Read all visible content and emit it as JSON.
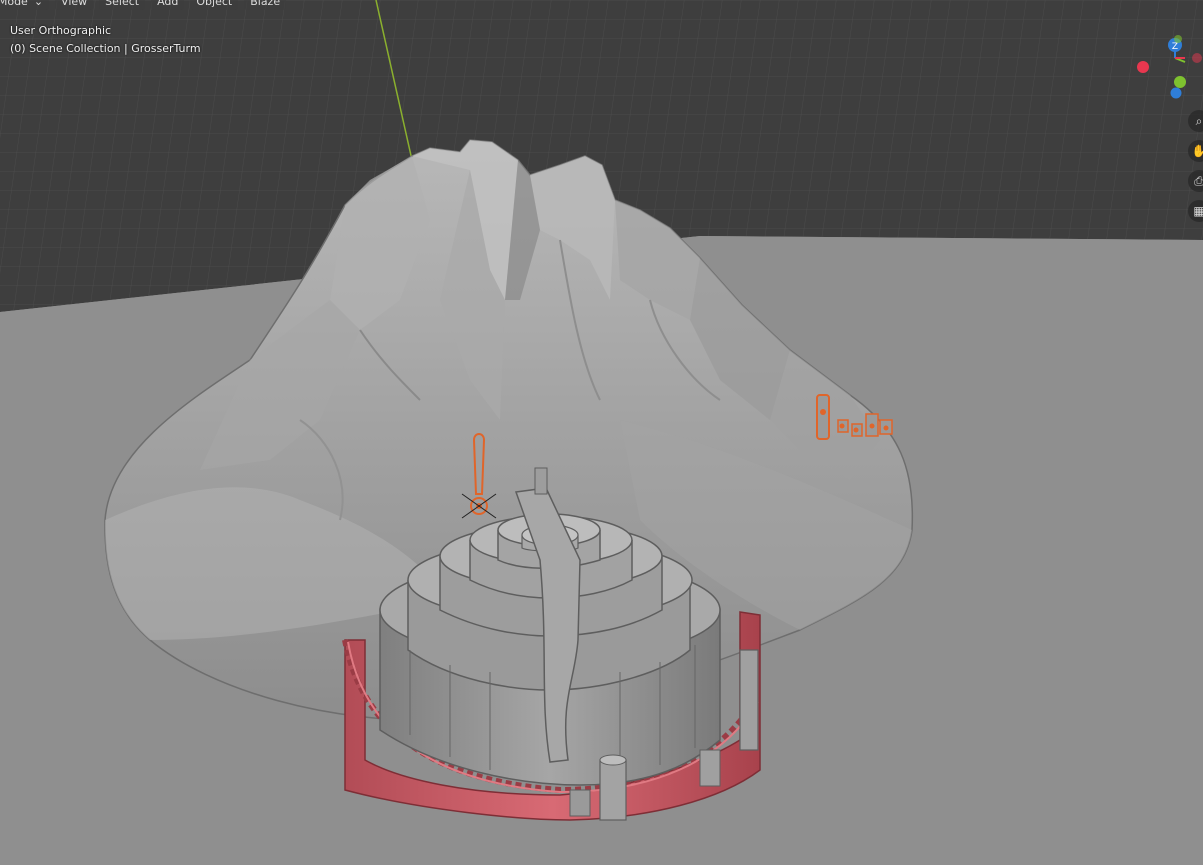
{
  "header": {
    "mode_label": "ct Mode",
    "menu": [
      "View",
      "Select",
      "Add",
      "Object",
      "Blaze"
    ]
  },
  "viewport": {
    "view_name": "User Orthographic",
    "collection_info": "(0) Scene Collection | GrosserTurm"
  },
  "gizmo": {
    "z_label": "Z",
    "x_color": "#e8374f",
    "y_color": "#7ec22f",
    "z_color": "#2f7ed8"
  },
  "nav_tools": [
    "zoom-icon",
    "pan-hand-icon",
    "camera-icon",
    "grid-icon"
  ],
  "colors": {
    "grid_bg": "#3d3d3d",
    "floor": "#8f8f8f",
    "mountain": "#9c9c9c",
    "wall": "#d0646c",
    "selection": "#e0652a"
  }
}
